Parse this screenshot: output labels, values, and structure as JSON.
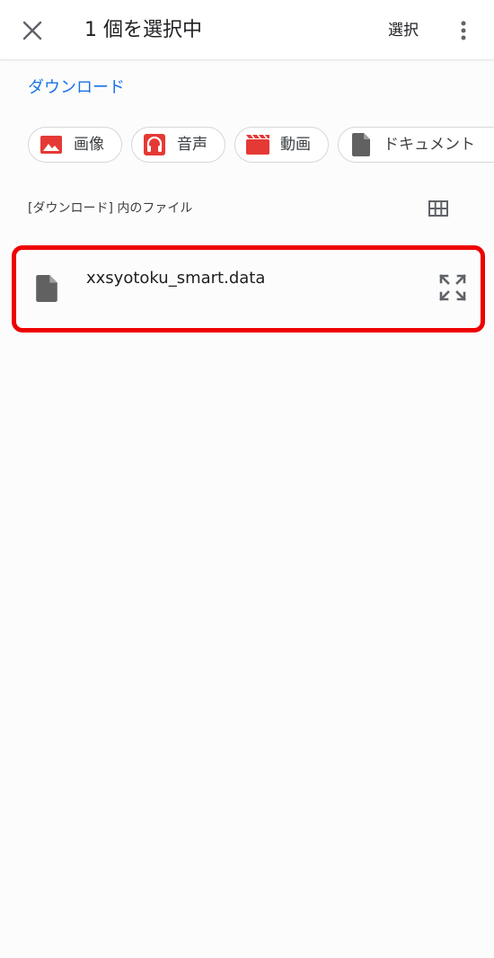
{
  "appbar": {
    "title": "1 個を選択中",
    "select_label": "選択",
    "close_icon": "close-icon",
    "more_icon": "more-vert-icon"
  },
  "folder": {
    "title": "ダウンロード"
  },
  "chips": [
    {
      "label": "画像",
      "icon": "image-icon",
      "color": "#e53935"
    },
    {
      "label": "音声",
      "icon": "headphones-icon",
      "color": "#e53935"
    },
    {
      "label": "動画",
      "icon": "movie-icon",
      "color": "#e53935"
    },
    {
      "label": "ドキュメント",
      "icon": "document-icon",
      "color": "#616161"
    }
  ],
  "section": {
    "label": "[ダウンロード] 内のファイル",
    "view_toggle_icon": "grid-view-icon"
  },
  "files": [
    {
      "name": "xxsyotoku_smart.data",
      "icon": "file-icon",
      "action_icon": "expand-icon",
      "selected": true
    }
  ],
  "colors": {
    "accent": "#1a73e8",
    "chip_icon": "#e53935",
    "highlight_border": "#ee0000",
    "background": "#fcfcfc"
  }
}
